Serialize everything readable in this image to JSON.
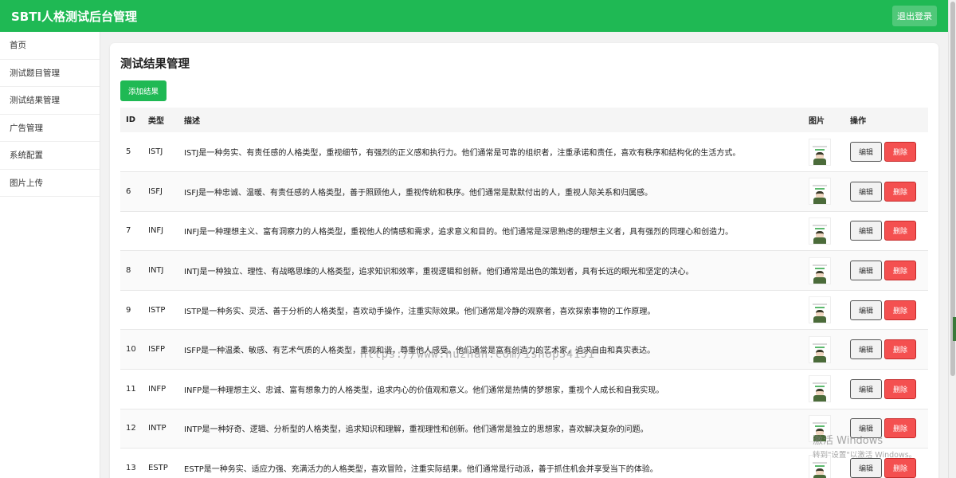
{
  "header": {
    "app_title": "SBTI人格测试后台管理",
    "logout_label": "退出登录",
    "brand_color": "#1fb954"
  },
  "sidebar": {
    "items": [
      {
        "label": "首页"
      },
      {
        "label": "测试题目管理"
      },
      {
        "label": "测试结果管理"
      },
      {
        "label": "广告管理"
      },
      {
        "label": "系统配置"
      },
      {
        "label": "图片上传"
      }
    ]
  },
  "main": {
    "page_title": "测试结果管理",
    "add_label": "添加结果",
    "table": {
      "columns": [
        "ID",
        "类型",
        "描述",
        "图片",
        "操作"
      ],
      "edit_label": "编辑",
      "delete_label": "删除",
      "rows": [
        {
          "id": "5",
          "type": "ISTJ",
          "desc": "ISTJ是一种务实、有责任感的人格类型，重视细节，有强烈的正义感和执行力。他们通常是可靠的组织者，注重承诺和责任，喜欢有秩序和结构化的生活方式。",
          "image_icon": "character-thumbnail"
        },
        {
          "id": "6",
          "type": "ISFJ",
          "desc": "ISFJ是一种忠诚、温暖、有责任感的人格类型，善于照顾他人，重视传统和秩序。他们通常是默默付出的人，重视人际关系和归属感。",
          "image_icon": "character-thumbnail"
        },
        {
          "id": "7",
          "type": "INFJ",
          "desc": "INFJ是一种理想主义、富有洞察力的人格类型，重视他人的情感和需求，追求意义和目的。他们通常是深思熟虑的理想主义者，具有强烈的同理心和创造力。",
          "image_icon": "character-face-thumbnail"
        },
        {
          "id": "8",
          "type": "INTJ",
          "desc": "INTJ是一种独立、理性、有战略思维的人格类型，追求知识和效率，重视逻辑和创新。他们通常是出色的策划者，具有长远的眼光和坚定的决心。",
          "image_icon": "character-thumbnail"
        },
        {
          "id": "9",
          "type": "ISTP",
          "desc": "ISTP是一种务实、灵活、善于分析的人格类型，喜欢动手操作，注重实际效果。他们通常是冷静的观察者，喜欢探索事物的工作原理。",
          "image_icon": "character-thumbnail"
        },
        {
          "id": "10",
          "type": "ISFP",
          "desc": "ISFP是一种温柔、敏感、有艺术气质的人格类型，重视和谐，尊重他人感受。他们通常是富有创造力的艺术家，追求自由和真实表达。",
          "image_icon": "character-face-thumbnail"
        },
        {
          "id": "11",
          "type": "INFP",
          "desc": "INFP是一种理想主义、忠诚、富有想象力的人格类型，追求内心的价值观和意义。他们通常是热情的梦想家，重视个人成长和自我实现。",
          "image_icon": "character-thumbnail"
        },
        {
          "id": "12",
          "type": "INTP",
          "desc": "INTP是一种好奇、逻辑、分析型的人格类型，追求知识和理解，重视理性和创新。他们通常是独立的思想家，喜欢解决复杂的问题。",
          "image_icon": "character-thumbnail"
        },
        {
          "id": "13",
          "type": "ESTP",
          "desc": "ESTP是一种务实、适应力强、充满活力的人格类型，喜欢冒险，注重实际结果。他们通常是行动派，善于抓住机会并享受当下的体验。",
          "image_icon": "character-thumbnail"
        }
      ]
    }
  },
  "overlay": {
    "watermark": "https://www.huzhan.com/ishop54151",
    "activation_title": "激活 Windows",
    "activation_sub": "转到\"设置\"以激活 Windows。"
  }
}
